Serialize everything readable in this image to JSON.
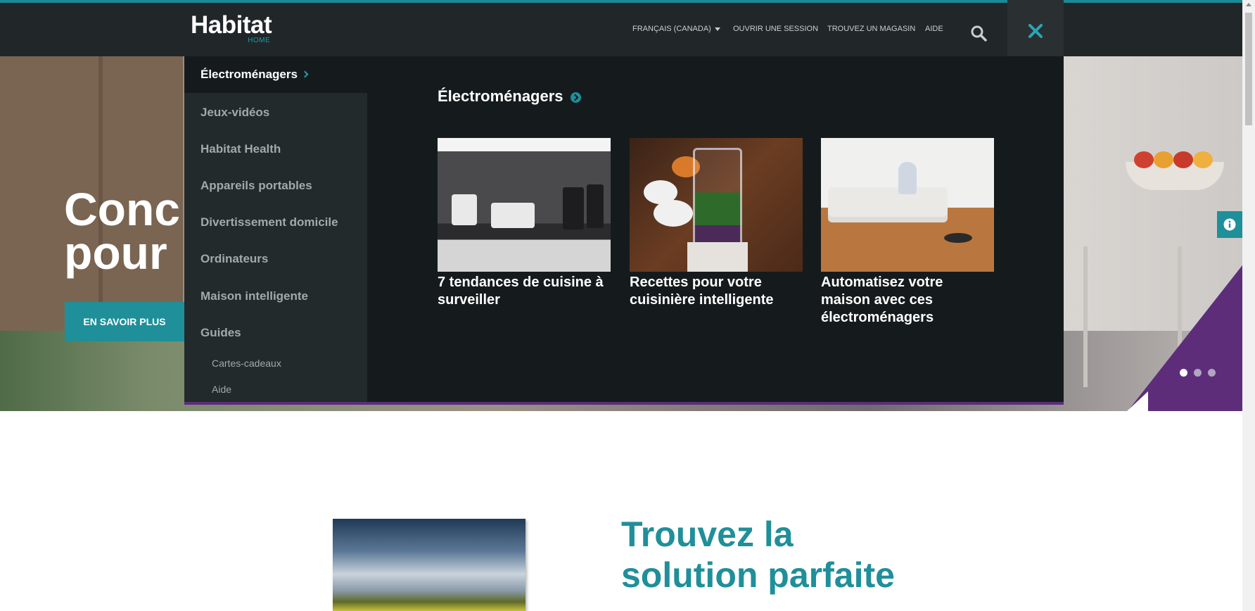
{
  "header": {
    "logo": {
      "brand": "Habitat",
      "sub": "HOME"
    },
    "language": "FRANÇAIS (CANADA)",
    "login": "OUVRIR UNE SESSION",
    "store": "TROUVEZ UN MAGASIN",
    "help": "AIDE"
  },
  "hero": {
    "title_line1": "Conc",
    "title_line2": "pour",
    "button": "EN SAVOIR PLUS",
    "slides": 3,
    "active_slide": 1
  },
  "menu": {
    "categories": [
      {
        "label": "Électroménagers",
        "active": true
      },
      {
        "label": "Jeux-vidéos"
      },
      {
        "label": "Habitat Health"
      },
      {
        "label": "Appareils portables"
      },
      {
        "label": "Divertissement domicile"
      },
      {
        "label": "Ordinateurs"
      },
      {
        "label": "Maison intelligente"
      },
      {
        "label": "Guides"
      }
    ],
    "sublinks": [
      {
        "label": "Cartes-cadeaux"
      },
      {
        "label": "Aide"
      }
    ],
    "panel": {
      "title": "Électroménagers",
      "cards": [
        {
          "caption": "7 tendances de cuisine à surveiller"
        },
        {
          "caption": "Recettes pour votre cuisinière intelligente"
        },
        {
          "caption": "Automatisez votre maison avec ces électroménagers"
        }
      ]
    }
  },
  "lower": {
    "title_line1": "Trouvez la",
    "title_line2": "solution parfaite"
  },
  "colors": {
    "accent": "#1f8f9a",
    "purple": "#5d2d7a",
    "header_bg": "#212729",
    "menu_bg": "#151b1d"
  },
  "icons": [
    "search-icon",
    "close-icon",
    "chevron-right-icon",
    "arrow-circle-icon",
    "info-icon"
  ]
}
